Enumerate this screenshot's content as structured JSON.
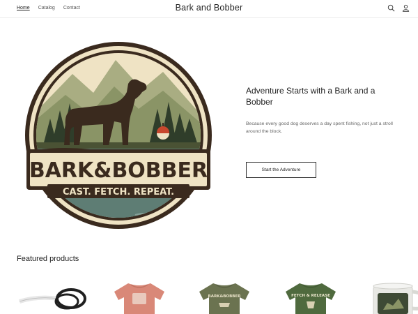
{
  "header": {
    "nav": [
      "Home",
      "Catalog",
      "Contact"
    ],
    "brand": "Bark and Bobber",
    "icons": [
      "search-icon",
      "account-icon"
    ]
  },
  "hero": {
    "logo": {
      "main_text": "BARK&BOBBER",
      "tagline": "CAST. FETCH. REPEAT."
    },
    "title": "Adventure Starts with a Bark and a Bobber",
    "subtitle": "Because every good dog deserves a day spent fishing, not just a stroll around the block.",
    "cta_label": "Start the Adventure"
  },
  "featured": {
    "title": "Featured products",
    "products": [
      {
        "kind": "leash",
        "print": ""
      },
      {
        "kind": "tshirt",
        "color": "#d98878",
        "print": ""
      },
      {
        "kind": "tshirt",
        "color": "#6b7350",
        "print": "BARK&BOBBER"
      },
      {
        "kind": "tshirt",
        "color": "#4f6a3e",
        "print": "FETCH & RELEASE"
      },
      {
        "kind": "mug",
        "color": "#e8e8e4",
        "print": ""
      }
    ]
  },
  "colors": {
    "cream": "#efe3c4",
    "dark_brown": "#3a2a1e",
    "olive": "#8a9466",
    "sage": "#a9ad82",
    "water": "#5e7d74",
    "pine": "#2f3d2a"
  }
}
